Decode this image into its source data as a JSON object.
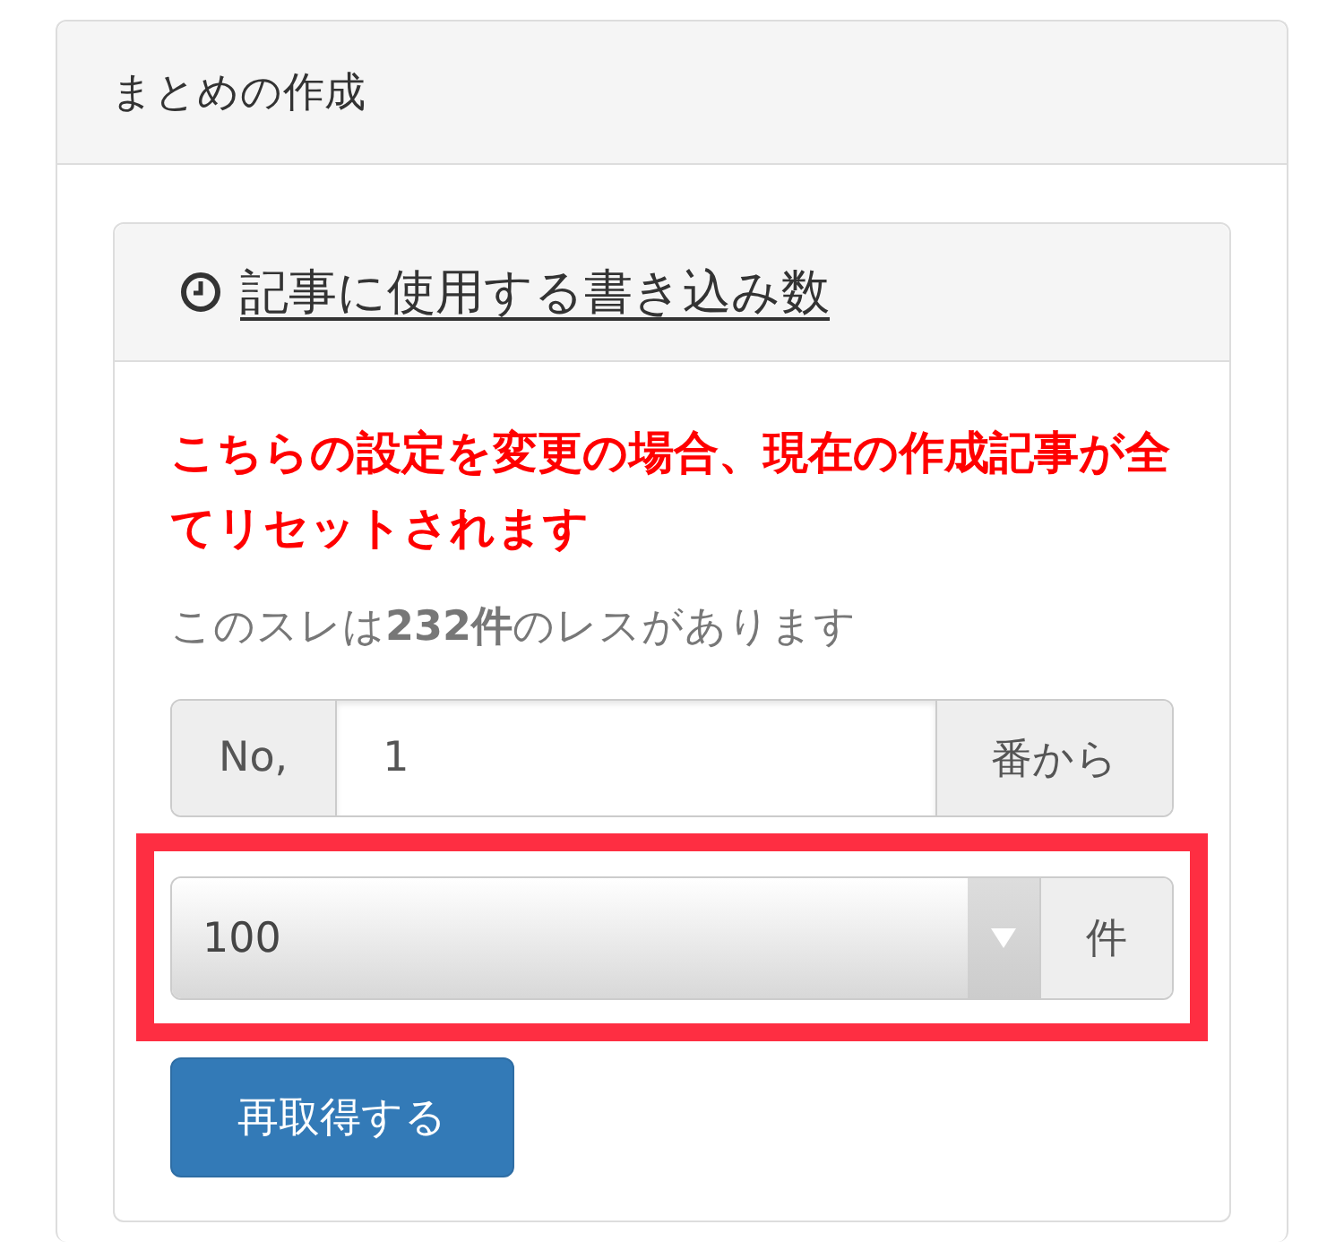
{
  "panel": {
    "title": "まとめの作成"
  },
  "section": {
    "title": "記事に使用する書き込み数",
    "warning": "こちらの設定を変更の場合、現在の作成記事が全てリセットされます",
    "info": "このスレは**232件**のレスがあります",
    "start_field": {
      "prefix": "No,",
      "value": "1",
      "suffix": "番から"
    },
    "count_select": {
      "value": "100",
      "suffix": "件",
      "highlighted": true
    },
    "button": "再取得する"
  }
}
